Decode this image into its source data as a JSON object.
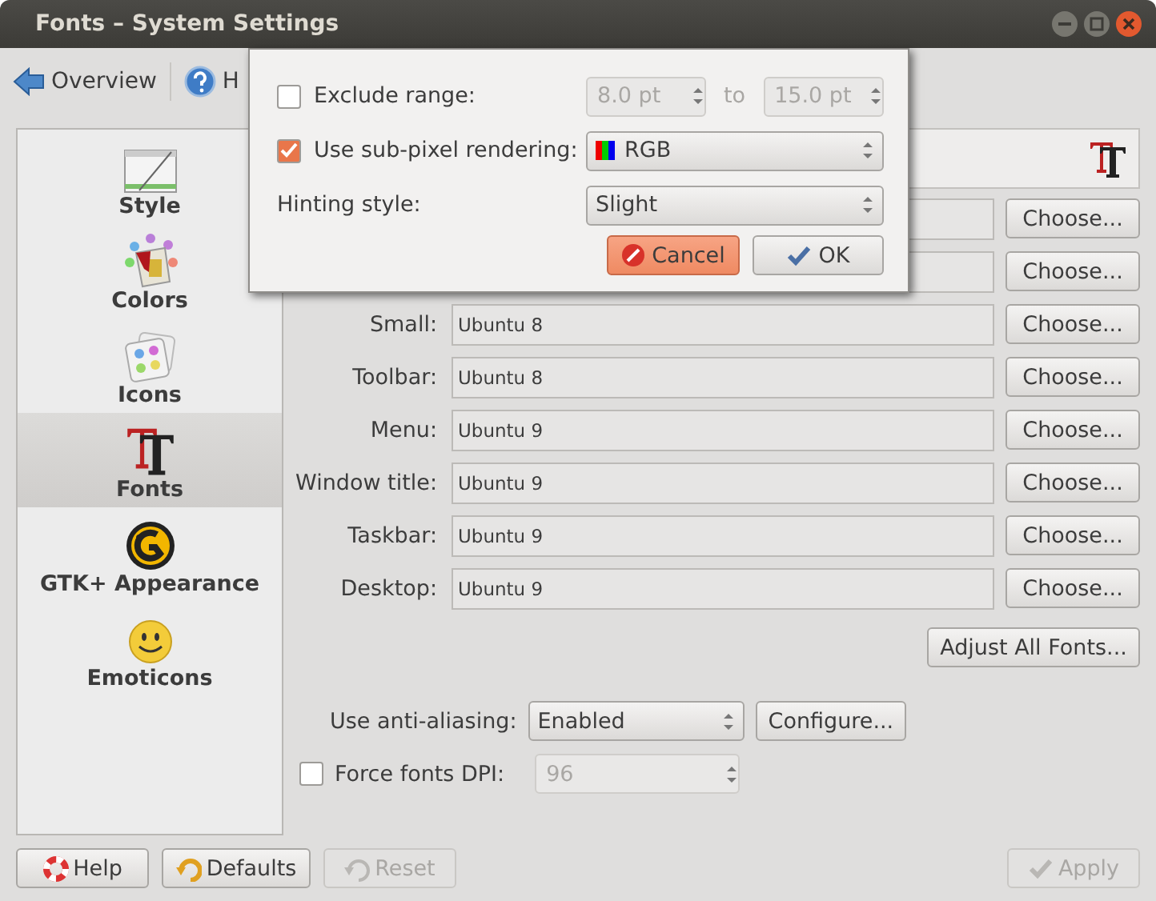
{
  "window": {
    "title": "Fonts – System Settings"
  },
  "toolbar": [
    {
      "label": "Overview",
      "kind": "back"
    },
    {
      "label": "H",
      "kind": "help"
    }
  ],
  "sidebar": {
    "items": [
      {
        "label": "Style",
        "kind": "style",
        "selected": false
      },
      {
        "label": "Colors",
        "kind": "colors",
        "selected": false
      },
      {
        "label": "Icons",
        "kind": "icons",
        "selected": false
      },
      {
        "label": "Fonts",
        "kind": "fonts",
        "selected": true
      },
      {
        "label": "GTK+ Appearance",
        "kind": "gtk",
        "selected": false
      },
      {
        "label": "Emoticons",
        "kind": "emoticons",
        "selected": false
      }
    ]
  },
  "font_rows": [
    {
      "button": "Choose..."
    },
    {
      "button": "Choose..."
    },
    {
      "label": "Small:",
      "value": "Ubuntu 8",
      "button": "Choose..."
    },
    {
      "label": "Toolbar:",
      "value": "Ubuntu 8",
      "button": "Choose..."
    },
    {
      "label": "Menu:",
      "value": "Ubuntu 9",
      "button": "Choose..."
    },
    {
      "label": "Window title:",
      "value": "Ubuntu 9",
      "button": "Choose..."
    },
    {
      "label": "Taskbar:",
      "value": "Ubuntu 9",
      "button": "Choose..."
    },
    {
      "label": "Desktop:",
      "value": "Ubuntu 9",
      "button": "Choose..."
    }
  ],
  "adjust_button": "Adjust All Fonts...",
  "anti_aliasing": {
    "label": "Use anti-aliasing:",
    "value": "Enabled",
    "button": "Configure..."
  },
  "force_dpi": {
    "label": "Force fonts DPI:",
    "checked": false,
    "value": "96",
    "disabled": true
  },
  "buttons": [
    {
      "label": "Help",
      "kind": "help",
      "disabled": false
    },
    {
      "label": "Defaults",
      "kind": "defaults",
      "disabled": false
    },
    {
      "label": "Reset",
      "kind": "reset",
      "disabled": true
    },
    {
      "label": "Apply",
      "kind": "apply",
      "disabled": true
    }
  ],
  "popup": {
    "exclude": {
      "label": "Exclude range:",
      "checked": false,
      "from": "8.0 pt",
      "to_label": "to",
      "to": "15.0 pt",
      "disabled": true
    },
    "subpixel": {
      "label": "Use sub-pixel rendering:",
      "checked": true,
      "value": "RGB"
    },
    "hinting": {
      "label": "Hinting style:",
      "value": "Slight"
    },
    "buttons": [
      {
        "label": "Cancel",
        "kind": "cancel",
        "focused": true
      },
      {
        "label": "OK",
        "kind": "ok",
        "focused": false
      }
    ]
  }
}
